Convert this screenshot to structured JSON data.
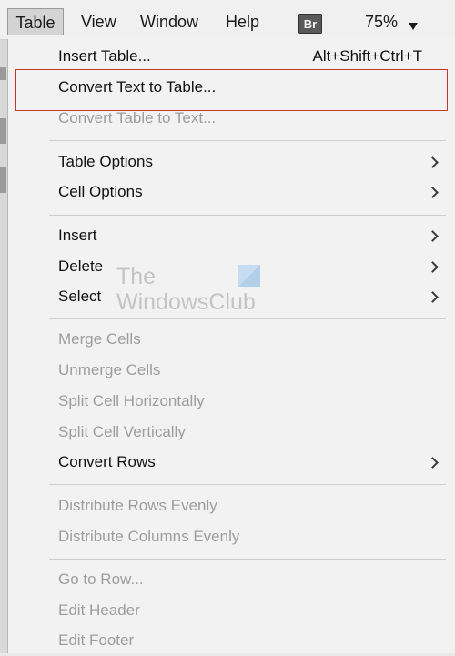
{
  "menubar": {
    "items": [
      "Table",
      "View",
      "Window",
      "Help"
    ],
    "bridge_badge": "Br",
    "zoom": "75%"
  },
  "menu": {
    "items": [
      {
        "label": "Insert Table...",
        "shortcut": "Alt+Shift+Ctrl+T",
        "enabled": true
      },
      {
        "label": "Convert Text to Table...",
        "enabled": true,
        "highlighted": true
      },
      {
        "label": "Convert Table to Text...",
        "enabled": false
      },
      {
        "label": "Table Options",
        "enabled": true,
        "submenu": true
      },
      {
        "label": "Cell Options",
        "enabled": true,
        "submenu": true
      },
      {
        "label": "Insert",
        "enabled": true,
        "submenu": true
      },
      {
        "label": "Delete",
        "enabled": true,
        "submenu": true
      },
      {
        "label": "Select",
        "enabled": true,
        "submenu": true
      },
      {
        "label": "Merge Cells",
        "enabled": false
      },
      {
        "label": "Unmerge Cells",
        "enabled": false
      },
      {
        "label": "Split Cell Horizontally",
        "enabled": false
      },
      {
        "label": "Split Cell Vertically",
        "enabled": false
      },
      {
        "label": "Convert Rows",
        "enabled": true,
        "submenu": true
      },
      {
        "label": "Distribute Rows Evenly",
        "enabled": false
      },
      {
        "label": "Distribute Columns Evenly",
        "enabled": false
      },
      {
        "label": "Go to Row...",
        "enabled": false
      },
      {
        "label": "Edit Header",
        "enabled": false
      },
      {
        "label": "Edit Footer",
        "enabled": false
      }
    ]
  },
  "watermark": {
    "line1": "The",
    "line2": "WindowsClub"
  },
  "colors": {
    "highlight_border": "#c0392b",
    "disabled_text": "#9d9d9d",
    "menu_background": "#f2f2f2"
  },
  "icons": {
    "submenu_arrow": "chevron-right-icon",
    "zoom_dropdown": "caret-down-icon"
  }
}
